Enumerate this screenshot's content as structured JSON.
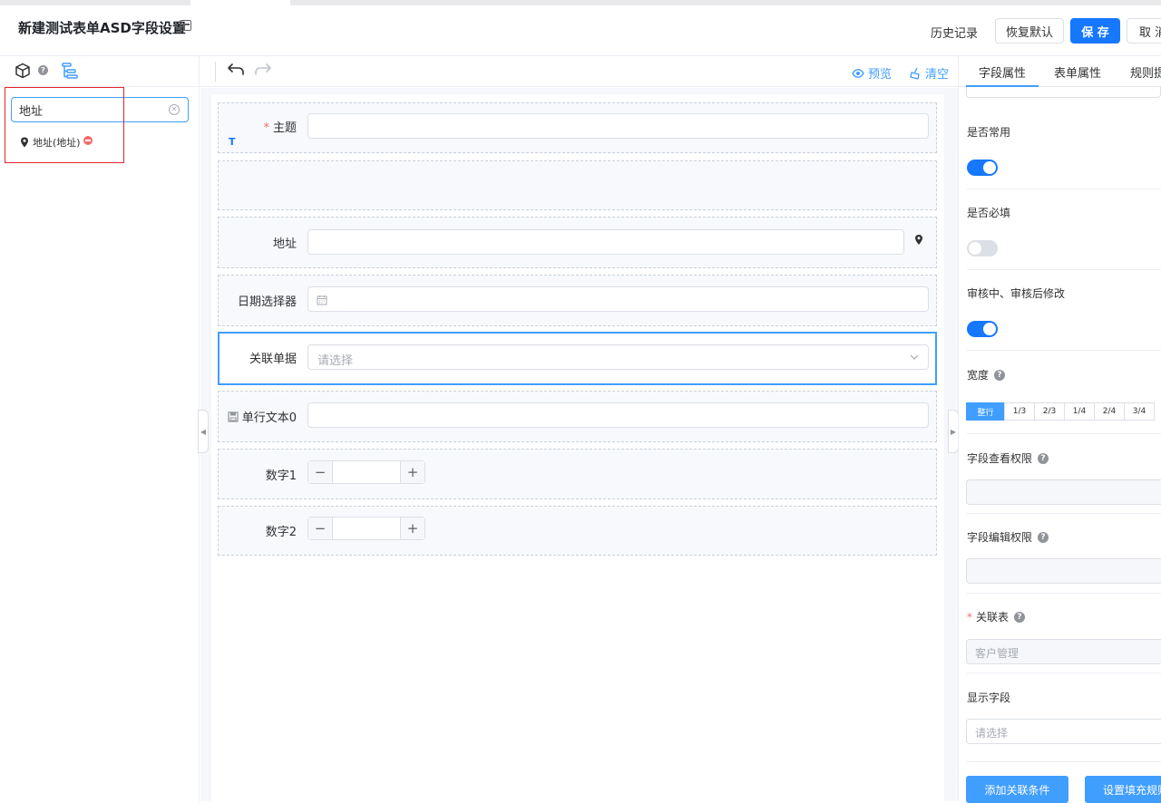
{
  "header": {
    "title": "新建测试表单ASD字段设置",
    "history": "历史记录",
    "restore": "恢复默认",
    "save": "保 存",
    "cancel": "取 消"
  },
  "left": {
    "search_value": "地址",
    "result_label": "地址(地址)"
  },
  "toolbar": {
    "preview": "预览",
    "clear": "清空"
  },
  "form": {
    "subject_label": "主题",
    "subject_type_badge": "T",
    "address_label": "地址",
    "date_label": "日期选择器",
    "relation_label": "关联单据",
    "relation_placeholder": "请选择",
    "text_label": "单行文本0",
    "number1_label": "数字1",
    "number2_label": "数字2"
  },
  "right": {
    "tabs": [
      "字段属性",
      "表单属性",
      "规则提"
    ],
    "common_label": "是否常用",
    "required_label": "是否必填",
    "modify_label": "审核中、审核后修改",
    "width_label": "宽度",
    "width_options": [
      "整行",
      "1/3",
      "2/3",
      "1/4",
      "2/4",
      "3/4"
    ],
    "view_perm_label": "字段查看权限",
    "edit_perm_label": "字段编辑权限",
    "relation_table_label": "关联表",
    "relation_table_value": "客户管理",
    "display_field_label": "显示字段",
    "display_field_placeholder": "请选择",
    "add_condition": "添加关联条件",
    "fill_rule": "设置填充规则"
  },
  "colors": {
    "primary": "#1677ff",
    "accent": "#409eff",
    "danger": "#f56c6c"
  }
}
